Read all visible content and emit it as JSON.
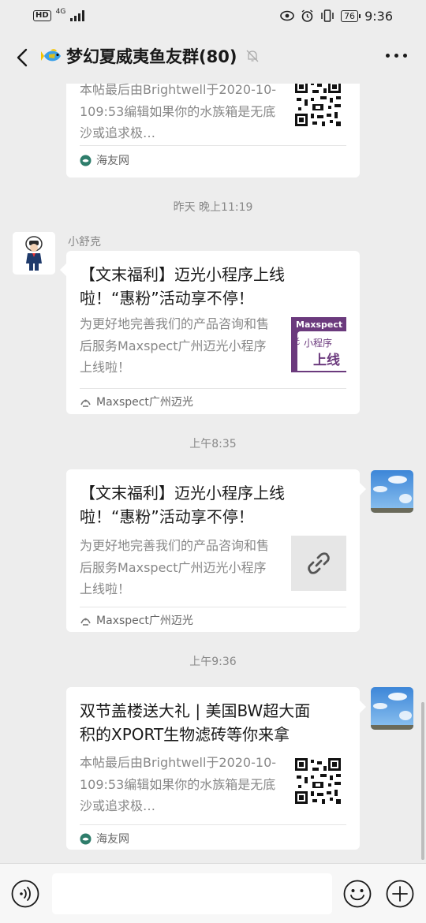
{
  "status_bar": {
    "hd": "HD",
    "network": "4G",
    "time": "9:36",
    "battery": "76"
  },
  "header": {
    "title": "梦幻夏威夷鱼友群(80)"
  },
  "messages": [
    {
      "type": "card-partial",
      "desc": "本帖最后由Brightwell于2020-10-109:53编辑如果你的水族箱是无底沙或追求极…",
      "source": "海友网"
    },
    {
      "type": "timestamp",
      "text": "昨天 晚上11:19"
    },
    {
      "type": "card",
      "sender": "小舒克",
      "title": "【文末福利】迈光小程序上线啦！“惠粉”活动享不停！",
      "desc": "为更好地完善我们的产品咨询和售后服务Maxspect广州迈光小程序上线啦！",
      "thumb_text_top": "Maxspect",
      "thumb_text_mid": "小程序",
      "thumb_text_bottom": "上线",
      "thumb_text_left": "光",
      "source": "Maxspect广州迈光"
    },
    {
      "type": "timestamp",
      "text": "上午8:35"
    },
    {
      "type": "card",
      "title": "【文末福利】迈光小程序上线啦！“惠粉”活动享不停！",
      "desc": "为更好地完善我们的产品咨询和售后服务Maxspect广州迈光小程序上线啦！",
      "source": "Maxspect广州迈光"
    },
    {
      "type": "timestamp",
      "text": "上午9:36"
    },
    {
      "type": "card",
      "title": "双节盖楼送大礼 | 美国BW超大面积的XPORT生物滤砖等你来拿",
      "desc": "本帖最后由Brightwell于2020-10-109:53编辑如果你的水族箱是无底沙或追求极…",
      "source": "海友网"
    }
  ],
  "input_bar": {
    "placeholder": ""
  },
  "colors": {
    "background": "#ededed",
    "card": "#ffffff",
    "thumb_purple": "#6b3a7d",
    "source_green": "#2e7d6b"
  }
}
